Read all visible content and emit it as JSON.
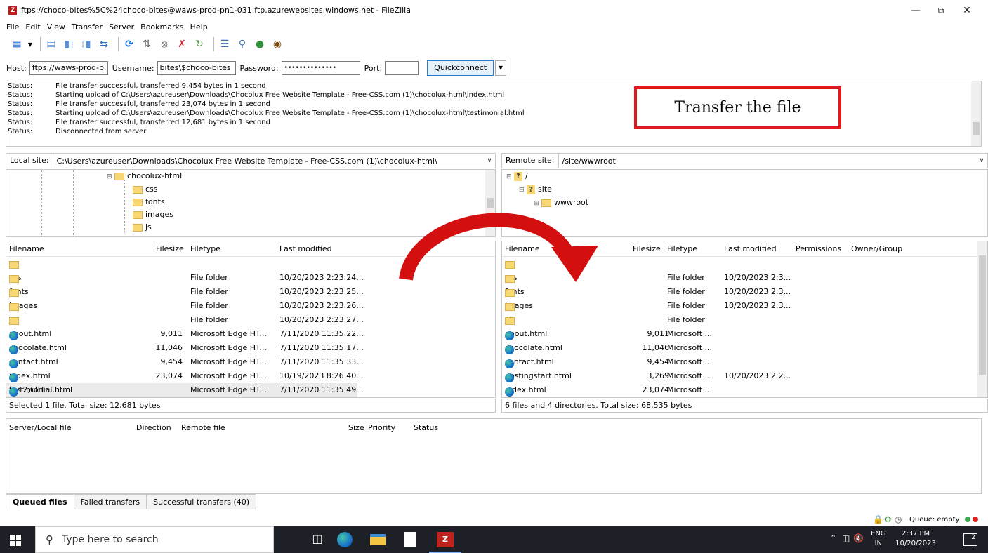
{
  "window": {
    "title": "ftps://choco-bites%5C%24choco-bites@waws-prod-pn1-031.ftp.azurewebsites.windows.net - FileZilla",
    "app_icon": "filezilla-icon"
  },
  "menu": [
    "File",
    "Edit",
    "View",
    "Transfer",
    "Server",
    "Bookmarks",
    "Help"
  ],
  "toolbar_icons": [
    "site-manager-icon",
    "toggle-log-icon",
    "toggle-local-tree-icon",
    "toggle-remote-tree-icon",
    "toggle-queue-icon",
    "refresh-icon",
    "process-queue-icon",
    "cancel-icon",
    "disconnect-icon",
    "reconnect-icon",
    "filter-icon",
    "search-remote-icon",
    "compare-icon",
    "find-files-icon"
  ],
  "quickconnect": {
    "host_label": "Host:",
    "host_value": "ftps://waws-prod-p",
    "username_label": "Username:",
    "username_value": "bites\\$choco-bites",
    "password_label": "Password:",
    "password_value": "••••••••••••••",
    "port_label": "Port:",
    "port_value": "",
    "button": "Quickconnect"
  },
  "log": [
    {
      "k": "Status:",
      "v": "File transfer successful, transferred 9,454 bytes in 1 second"
    },
    {
      "k": "Status:",
      "v": "Starting upload of C:\\Users\\azureuser\\Downloads\\Chocolux Free Website Template - Free-CSS.com (1)\\chocolux-html\\index.html"
    },
    {
      "k": "Status:",
      "v": "File transfer successful, transferred 23,074 bytes in 1 second"
    },
    {
      "k": "Status:",
      "v": "Starting upload of C:\\Users\\azureuser\\Downloads\\Chocolux Free Website Template - Free-CSS.com (1)\\chocolux-html\\testimonial.html"
    },
    {
      "k": "Status:",
      "v": "File transfer successful, transferred 12,681 bytes in 1 second"
    },
    {
      "k": "Status:",
      "v": "Disconnected from server"
    }
  ],
  "annotation": "Transfer the file",
  "local": {
    "site_label": "Local site:",
    "site_path": "C:\\Users\\azureuser\\Downloads\\Chocolux Free Website Template - Free-CSS.com (1)\\chocolux-html\\",
    "tree": [
      "chocolux-html",
      "css",
      "fonts",
      "images",
      "js"
    ],
    "headers": {
      "name": "Filename",
      "size": "Filesize",
      "type": "Filetype",
      "modified": "Last modified"
    },
    "files": [
      {
        "name": "..",
        "size": "",
        "type": "",
        "modified": "",
        "icon": "folder"
      },
      {
        "name": "css",
        "size": "",
        "type": "File folder",
        "modified": "10/20/2023 2:23:24...",
        "icon": "folder"
      },
      {
        "name": "fonts",
        "size": "",
        "type": "File folder",
        "modified": "10/20/2023 2:23:25...",
        "icon": "folder"
      },
      {
        "name": "images",
        "size": "",
        "type": "File folder",
        "modified": "10/20/2023 2:23:26...",
        "icon": "folder"
      },
      {
        "name": "js",
        "size": "",
        "type": "File folder",
        "modified": "10/20/2023 2:23:27...",
        "icon": "folder"
      },
      {
        "name": "about.html",
        "size": "9,011",
        "type": "Microsoft Edge HT...",
        "modified": "7/11/2020 11:35:22...",
        "icon": "edge"
      },
      {
        "name": "chocolate.html",
        "size": "11,046",
        "type": "Microsoft Edge HT...",
        "modified": "7/11/2020 11:35:17...",
        "icon": "edge"
      },
      {
        "name": "contact.html",
        "size": "9,454",
        "type": "Microsoft Edge HT...",
        "modified": "7/11/2020 11:35:33...",
        "icon": "edge"
      },
      {
        "name": "index.html",
        "size": "23,074",
        "type": "Microsoft Edge HT...",
        "modified": "10/19/2023 8:26:40...",
        "icon": "edge"
      },
      {
        "name": "testimonial.html",
        "size": "12,681",
        "type": "Microsoft Edge HT...",
        "modified": "7/11/2020 11:35:49...",
        "icon": "edge",
        "selected": true
      }
    ],
    "status": "Selected 1 file. Total size: 12,681 bytes"
  },
  "remote": {
    "site_label": "Remote site:",
    "site_path": "/site/wwwroot",
    "tree": [
      "/",
      "site",
      "wwwroot"
    ],
    "headers": {
      "name": "Filename",
      "size": "Filesize",
      "type": "Filetype",
      "modified": "Last modified",
      "perms": "Permissions",
      "owner": "Owner/Group"
    },
    "files": [
      {
        "name": "..",
        "size": "",
        "type": "",
        "modified": "",
        "icon": "folder"
      },
      {
        "name": "css",
        "size": "",
        "type": "File folder",
        "modified": "10/20/2023 2:3...",
        "icon": "folder"
      },
      {
        "name": "fonts",
        "size": "",
        "type": "File folder",
        "modified": "10/20/2023 2:3...",
        "icon": "folder"
      },
      {
        "name": "images",
        "size": "",
        "type": "File folder",
        "modified": "10/20/2023 2:3...",
        "icon": "folder"
      },
      {
        "name": "js",
        "size": "",
        "type": "File folder",
        "modified": "",
        "icon": "folder"
      },
      {
        "name": "about.html",
        "size": "9,011",
        "type": "Microsoft ...",
        "modified": "",
        "icon": "edge"
      },
      {
        "name": "chocolate.html",
        "size": "11,046",
        "type": "Microsoft ...",
        "modified": "",
        "icon": "edge"
      },
      {
        "name": "contact.html",
        "size": "9,454",
        "type": "Microsoft ...",
        "modified": "",
        "icon": "edge"
      },
      {
        "name": "hostingstart.html",
        "size": "3,269",
        "type": "Microsoft ...",
        "modified": "10/20/2023 2:2...",
        "icon": "edge"
      },
      {
        "name": "index.html",
        "size": "23,074",
        "type": "Microsoft ...",
        "modified": "",
        "icon": "edge"
      }
    ],
    "status": "6 files and 4 directories. Total size: 68,535 bytes"
  },
  "queue": {
    "headers": [
      "Server/Local file",
      "Direction",
      "Remote file",
      "Size",
      "Priority",
      "Status"
    ],
    "tabs": [
      "Queued files",
      "Failed transfers",
      "Successful transfers (40)"
    ]
  },
  "statusbar": {
    "queue": "Queue: empty"
  },
  "taskbar": {
    "search_placeholder": "Type here to search",
    "lang": "ENG",
    "region": "IN",
    "time": "2:37 PM",
    "date": "10/20/2023",
    "notif_count": "2"
  },
  "colors": {
    "arrow": "#d40f0f",
    "callout_border": "#e0191f",
    "taskbar": "#1d2026"
  }
}
